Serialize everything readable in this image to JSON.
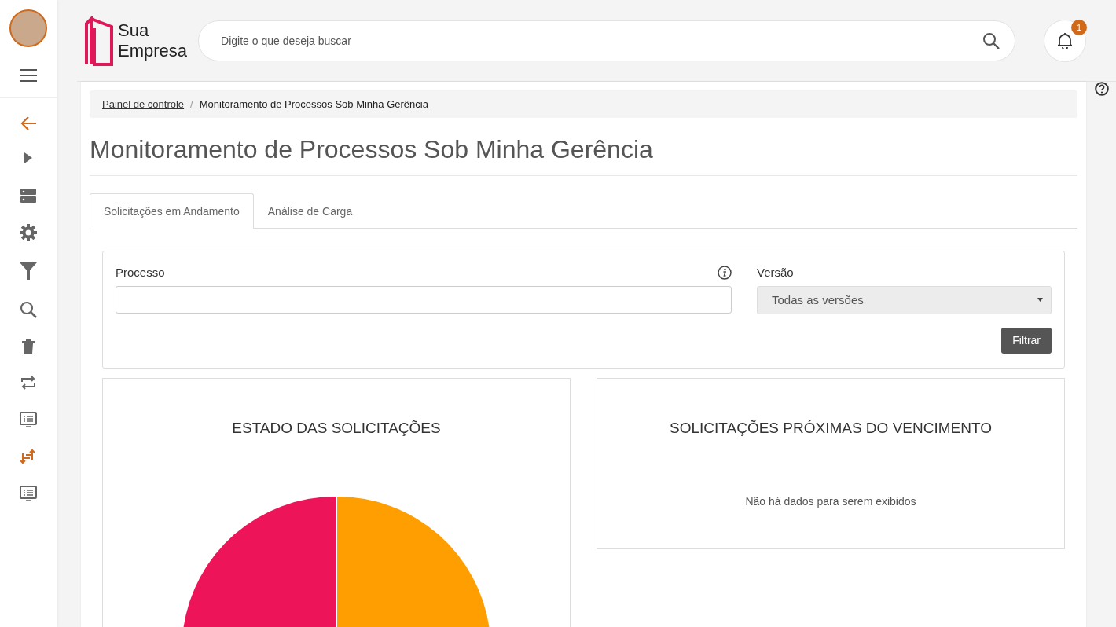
{
  "header": {
    "logo": {
      "line_1": "Sua",
      "line_2": "Empresa"
    },
    "search": {
      "placeholder": "Digite o que deseja buscar"
    },
    "notifications": {
      "count": "1"
    }
  },
  "breadcrumb_separator": "/",
  "breadcrumb": [
    {
      "label": "Painel de controle",
      "link": true
    },
    {
      "label": "Monitoramento de Processos Sob Minha Gerência",
      "link": false
    }
  ],
  "page_title": "Monitoramento de Processos Sob Minha Gerência",
  "tabs": [
    {
      "label": "Solicitações em Andamento",
      "selected": true
    },
    {
      "label": "Análise de Carga",
      "selected": false
    }
  ],
  "filter": {
    "process_label": "Processo",
    "version_label": "Versão",
    "version_value": "Todas as versões",
    "button": "Filtrar"
  },
  "panels": [
    {
      "title": "ESTADO DAS SOLICITAÇÕES",
      "kind": "pie"
    },
    {
      "title": "SOLICITAÇÕES PRÓXIMAS DO VENCIMENTO",
      "kind": "empty",
      "message": "Não há dados para serem exibidos"
    }
  ]
}
